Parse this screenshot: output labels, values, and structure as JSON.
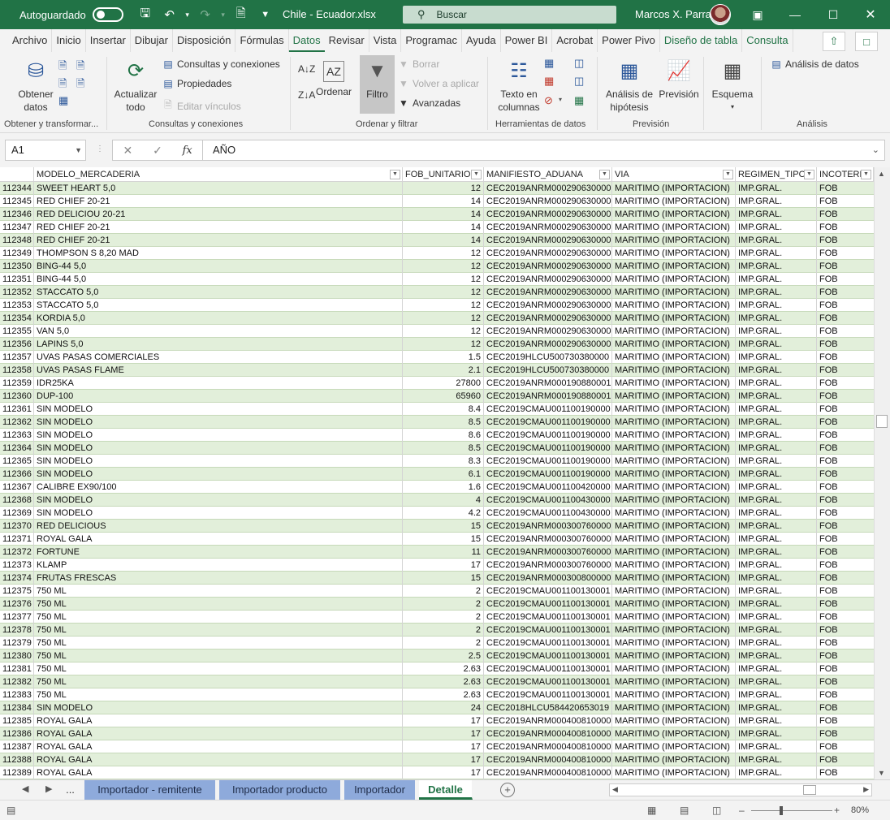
{
  "titlebar": {
    "autosave_label": "Autoguardado",
    "doc_title": "Chile - Ecuador.xlsx",
    "search_placeholder": "Buscar",
    "user_name": "Marcos X. Parra"
  },
  "tabs": [
    "Archivo",
    "Inicio",
    "Insertar",
    "Dibujar",
    "Disposición",
    "Fórmulas",
    "Datos",
    "Revisar",
    "Vista",
    "Programac",
    "Ayuda",
    "Power BI",
    "Acrobat",
    "Power Pivo",
    "Diseño de tabla",
    "Consulta"
  ],
  "active_tab": "Datos",
  "ribbon": {
    "obtener_datos": "Obtener\ndatos",
    "actualizar_todo": "Actualizar\ntodo",
    "consultas_conexiones": "Consultas y conexiones",
    "propiedades": "Propiedades",
    "editar_vinculos": "Editar vínculos",
    "ordenar": "Ordenar",
    "filtro": "Filtro",
    "borrar": "Borrar",
    "volver_aplicar": "Volver a aplicar",
    "avanzadas": "Avanzadas",
    "texto_columnas": "Texto en\ncolumnas",
    "analisis_hipotesis": "Análisis de\nhipótesis",
    "prevision": "Previsión",
    "esquema": "Esquema",
    "analisis_datos": "Análisis de datos",
    "groups": {
      "g1": "Obtener y transformar...",
      "g2": "Consultas y conexiones",
      "g3": "Ordenar y filtrar",
      "g4": "Herramientas de datos",
      "g5": "Previsión",
      "g6": "Análisis"
    }
  },
  "formula_bar": {
    "name_box": "A1",
    "formula": "AÑO"
  },
  "columns": [
    {
      "label": ""
    },
    {
      "label": "MODELO_MERCADERIA"
    },
    {
      "label": "FOB_UNITARIO"
    },
    {
      "label": "MANIFIESTO_ADUANA"
    },
    {
      "label": "VIA"
    },
    {
      "label": "REGIMEN_TIPO"
    },
    {
      "label": "INCOTERM"
    }
  ],
  "rows": [
    [
      "112344",
      "SWEET HEART 5,0",
      "12",
      "CEC2019ANRM000290630000",
      "MARITIMO (IMPORTACION)",
      "IMP.GRAL.",
      "FOB"
    ],
    [
      "112345",
      "RED CHIEF 20-21",
      "14",
      "CEC2019ANRM000290630000",
      "MARITIMO (IMPORTACION)",
      "IMP.GRAL.",
      "FOB"
    ],
    [
      "112346",
      "RED DELICIOU 20-21",
      "14",
      "CEC2019ANRM000290630000",
      "MARITIMO (IMPORTACION)",
      "IMP.GRAL.",
      "FOB"
    ],
    [
      "112347",
      "RED CHIEF 20-21",
      "14",
      "CEC2019ANRM000290630000",
      "MARITIMO (IMPORTACION)",
      "IMP.GRAL.",
      "FOB"
    ],
    [
      "112348",
      "RED CHIEF 20-21",
      "14",
      "CEC2019ANRM000290630000",
      "MARITIMO (IMPORTACION)",
      "IMP.GRAL.",
      "FOB"
    ],
    [
      "112349",
      "THOMPSON S 8,20 MAD",
      "12",
      "CEC2019ANRM000290630000",
      "MARITIMO (IMPORTACION)",
      "IMP.GRAL.",
      "FOB"
    ],
    [
      "112350",
      "BING-44 5,0",
      "12",
      "CEC2019ANRM000290630000",
      "MARITIMO (IMPORTACION)",
      "IMP.GRAL.",
      "FOB"
    ],
    [
      "112351",
      "BING-44 5,0",
      "12",
      "CEC2019ANRM000290630000",
      "MARITIMO (IMPORTACION)",
      "IMP.GRAL.",
      "FOB"
    ],
    [
      "112352",
      "STACCATO 5,0",
      "12",
      "CEC2019ANRM000290630000",
      "MARITIMO (IMPORTACION)",
      "IMP.GRAL.",
      "FOB"
    ],
    [
      "112353",
      "STACCATO 5,0",
      "12",
      "CEC2019ANRM000290630000",
      "MARITIMO (IMPORTACION)",
      "IMP.GRAL.",
      "FOB"
    ],
    [
      "112354",
      "KORDIA 5,0",
      "12",
      "CEC2019ANRM000290630000",
      "MARITIMO (IMPORTACION)",
      "IMP.GRAL.",
      "FOB"
    ],
    [
      "112355",
      "VAN 5,0",
      "12",
      "CEC2019ANRM000290630000",
      "MARITIMO (IMPORTACION)",
      "IMP.GRAL.",
      "FOB"
    ],
    [
      "112356",
      "LAPINS 5,0",
      "12",
      "CEC2019ANRM000290630000",
      "MARITIMO (IMPORTACION)",
      "IMP.GRAL.",
      "FOB"
    ],
    [
      "112357",
      "UVAS PASAS COMERCIALES",
      "1.5",
      "CEC2019HLCU500730380000",
      "MARITIMO (IMPORTACION)",
      "IMP.GRAL.",
      "FOB"
    ],
    [
      "112358",
      "UVAS PASAS FLAME",
      "2.1",
      "CEC2019HLCU500730380000",
      "MARITIMO (IMPORTACION)",
      "IMP.GRAL.",
      "FOB"
    ],
    [
      "112359",
      "IDR25KA",
      "27800",
      "CEC2019ANRM000190880001",
      "MARITIMO (IMPORTACION)",
      "IMP.GRAL.",
      "FOB"
    ],
    [
      "112360",
      "DUP-100",
      "65960",
      "CEC2019ANRM000190880001",
      "MARITIMO (IMPORTACION)",
      "IMP.GRAL.",
      "FOB"
    ],
    [
      "112361",
      "SIN MODELO",
      "8.4",
      "CEC2019CMAU001100190000",
      "MARITIMO (IMPORTACION)",
      "IMP.GRAL.",
      "FOB"
    ],
    [
      "112362",
      "SIN MODELO",
      "8.5",
      "CEC2019CMAU001100190000",
      "MARITIMO (IMPORTACION)",
      "IMP.GRAL.",
      "FOB"
    ],
    [
      "112363",
      "SIN MODELO",
      "8.6",
      "CEC2019CMAU001100190000",
      "MARITIMO (IMPORTACION)",
      "IMP.GRAL.",
      "FOB"
    ],
    [
      "112364",
      "SIN MODELO",
      "8.5",
      "CEC2019CMAU001100190000",
      "MARITIMO (IMPORTACION)",
      "IMP.GRAL.",
      "FOB"
    ],
    [
      "112365",
      "SIN MODELO",
      "8.3",
      "CEC2019CMAU001100190000",
      "MARITIMO (IMPORTACION)",
      "IMP.GRAL.",
      "FOB"
    ],
    [
      "112366",
      "SIN MODELO",
      "6.1",
      "CEC2019CMAU001100190000",
      "MARITIMO (IMPORTACION)",
      "IMP.GRAL.",
      "FOB"
    ],
    [
      "112367",
      "CALIBRE EX90/100",
      "1.6",
      "CEC2019CMAU001100420000",
      "MARITIMO (IMPORTACION)",
      "IMP.GRAL.",
      "FOB"
    ],
    [
      "112368",
      "SIN MODELO",
      "4",
      "CEC2019CMAU001100430000",
      "MARITIMO (IMPORTACION)",
      "IMP.GRAL.",
      "FOB"
    ],
    [
      "112369",
      "SIN MODELO",
      "4.2",
      "CEC2019CMAU001100430000",
      "MARITIMO (IMPORTACION)",
      "IMP.GRAL.",
      "FOB"
    ],
    [
      "112370",
      "RED DELICIOUS",
      "15",
      "CEC2019ANRM000300760000",
      "MARITIMO (IMPORTACION)",
      "IMP.GRAL.",
      "FOB"
    ],
    [
      "112371",
      "ROYAL GALA",
      "15",
      "CEC2019ANRM000300760000",
      "MARITIMO (IMPORTACION)",
      "IMP.GRAL.",
      "FOB"
    ],
    [
      "112372",
      "FORTUNE",
      "11",
      "CEC2019ANRM000300760000",
      "MARITIMO (IMPORTACION)",
      "IMP.GRAL.",
      "FOB"
    ],
    [
      "112373",
      "KLAMP",
      "17",
      "CEC2019ANRM000300760000",
      "MARITIMO (IMPORTACION)",
      "IMP.GRAL.",
      "FOB"
    ],
    [
      "112374",
      "FRUTAS FRESCAS",
      "15",
      "CEC2019ANRM000300800000",
      "MARITIMO (IMPORTACION)",
      "IMP.GRAL.",
      "FOB"
    ],
    [
      "112375",
      "750 ML",
      "2",
      "CEC2019CMAU001100130001",
      "MARITIMO (IMPORTACION)",
      "IMP.GRAL.",
      "FOB"
    ],
    [
      "112376",
      "750 ML",
      "2",
      "CEC2019CMAU001100130001",
      "MARITIMO (IMPORTACION)",
      "IMP.GRAL.",
      "FOB"
    ],
    [
      "112377",
      "750 ML",
      "2",
      "CEC2019CMAU001100130001",
      "MARITIMO (IMPORTACION)",
      "IMP.GRAL.",
      "FOB"
    ],
    [
      "112378",
      "750 ML",
      "2",
      "CEC2019CMAU001100130001",
      "MARITIMO (IMPORTACION)",
      "IMP.GRAL.",
      "FOB"
    ],
    [
      "112379",
      "750 ML",
      "2",
      "CEC2019CMAU001100130001",
      "MARITIMO (IMPORTACION)",
      "IMP.GRAL.",
      "FOB"
    ],
    [
      "112380",
      "750 ML",
      "2.5",
      "CEC2019CMAU001100130001",
      "MARITIMO (IMPORTACION)",
      "IMP.GRAL.",
      "FOB"
    ],
    [
      "112381",
      "750 ML",
      "2.63",
      "CEC2019CMAU001100130001",
      "MARITIMO (IMPORTACION)",
      "IMP.GRAL.",
      "FOB"
    ],
    [
      "112382",
      "750 ML",
      "2.63",
      "CEC2019CMAU001100130001",
      "MARITIMO (IMPORTACION)",
      "IMP.GRAL.",
      "FOB"
    ],
    [
      "112383",
      "750 ML",
      "2.63",
      "CEC2019CMAU001100130001",
      "MARITIMO (IMPORTACION)",
      "IMP.GRAL.",
      "FOB"
    ],
    [
      "112384",
      "SIN MODELO",
      "24",
      "CEC2018HLCU584420653019",
      "MARITIMO (IMPORTACION)",
      "IMP.GRAL.",
      "FOB"
    ],
    [
      "112385",
      "ROYAL GALA",
      "17",
      "CEC2019ANRM000400810000",
      "MARITIMO (IMPORTACION)",
      "IMP.GRAL.",
      "FOB"
    ],
    [
      "112386",
      "ROYAL GALA",
      "17",
      "CEC2019ANRM000400810000",
      "MARITIMO (IMPORTACION)",
      "IMP.GRAL.",
      "FOB"
    ],
    [
      "112387",
      "ROYAL GALA",
      "17",
      "CEC2019ANRM000400810000",
      "MARITIMO (IMPORTACION)",
      "IMP.GRAL.",
      "FOB"
    ],
    [
      "112388",
      "ROYAL GALA",
      "17",
      "CEC2019ANRM000400810000",
      "MARITIMO (IMPORTACION)",
      "IMP.GRAL.",
      "FOB"
    ],
    [
      "112389",
      "ROYAL GALA",
      "17",
      "CEC2019ANRM000400810000",
      "MARITIMO (IMPORTACION)",
      "IMP.GRAL.",
      "FOB"
    ]
  ],
  "sheet_tabs": [
    "...",
    "Importador - remitente",
    "Importador producto",
    "Importador",
    "Detalle"
  ],
  "active_sheet": "Detalle",
  "status": {
    "zoom": "80%",
    "zoom_level_percent": 80
  },
  "colors": {
    "brand": "#217346",
    "band": "#e2efda",
    "sheet_tab": "#8eaadb"
  }
}
